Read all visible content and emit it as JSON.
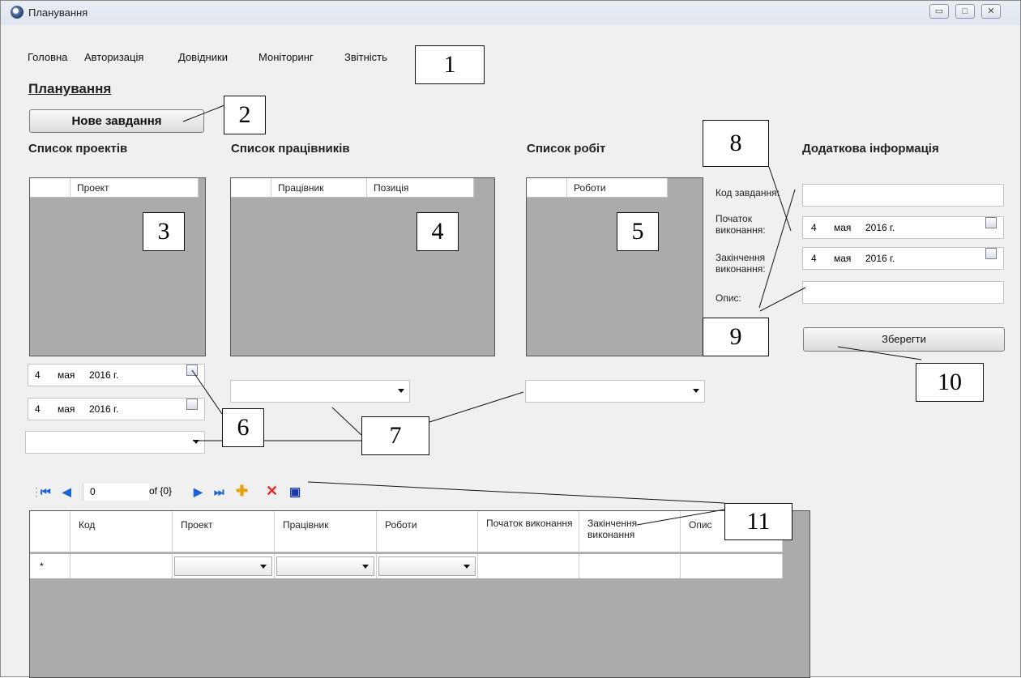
{
  "window": {
    "title": "Планування",
    "minimize": "▭",
    "maximize": "□",
    "close": "✕"
  },
  "menu": [
    "Головна",
    "Авторизація",
    "Довідники",
    "Моніторинг",
    "Звітність"
  ],
  "page": {
    "title": "Планування",
    "new_task_button": "Нове завдання"
  },
  "projects": {
    "heading": "Список проектів",
    "column": "Проект",
    "date_from": {
      "day": "4",
      "month": "мая",
      "year": "2016 г."
    },
    "date_to": {
      "day": "4",
      "month": "мая",
      "year": "2016 г."
    },
    "combo_value": ""
  },
  "workers": {
    "heading": "Список працівників",
    "columns": [
      "Працівник",
      "Позиція"
    ],
    "combo_value": ""
  },
  "works": {
    "heading": "Список робіт",
    "column": "Роботи",
    "combo_value": ""
  },
  "details": {
    "heading": "Додаткова інформація",
    "task_code_label": "Код завдання:",
    "start_label": "Початок виконання:",
    "end_label": "Закінчення виконання:",
    "description_label": "Опис:",
    "start_date": {
      "day": "4",
      "month": "мая",
      "year": "2016 г."
    },
    "end_date": {
      "day": "4",
      "month": "мая",
      "year": "2016 г."
    },
    "task_code_value": "",
    "description_value": "",
    "save_button": "Зберегти"
  },
  "navigator": {
    "position": "0",
    "count_text": "of {0}"
  },
  "grid": {
    "columns": [
      "Код",
      "Проект",
      "Працівник",
      "Роботи",
      "Початок виконання",
      "Закінчення виконання",
      "Опис"
    ],
    "new_row_marker": "*"
  },
  "callouts": [
    "1",
    "2",
    "3",
    "4",
    "5",
    "6",
    "7",
    "8",
    "9",
    "10",
    "11"
  ]
}
